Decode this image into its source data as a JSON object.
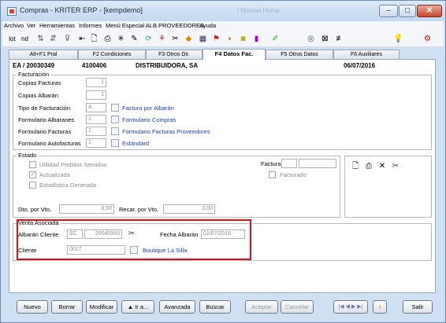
{
  "window": {
    "title": "Compras - KRITER ERP - [kempdemo]",
    "ghost_title": "! Normal   Home",
    "controls": {
      "minimize": "–",
      "maximize": "□",
      "close": "✕"
    }
  },
  "menu": [
    "Archivo",
    "Ver",
    "Herramientas",
    "Informes",
    "Menú Especial ALB.PROVEEDORES",
    "Ayuda"
  ],
  "toolbar": {
    "lot": "lot",
    "nd": "nd",
    "icons": [
      "sort-icon",
      "sort-desc-icon",
      "filter-icon",
      "back-icon",
      "preview-icon",
      "print-icon",
      "cross-icon",
      "edit-icon",
      "refresh-icon",
      "tree-icon",
      "tools-icon",
      "diamond-icon",
      "grid-icon",
      "flag-icon",
      "hide-icon",
      "camera-icon",
      "pencil-icon",
      "eye-icon",
      "image-icon",
      "tab-icon",
      "bulb-icon",
      "network-icon"
    ]
  },
  "tabs": [
    "Alt+F1 Pral",
    "F2 Condiciones",
    "F3 Otros Dir.",
    "F4 Datos Fac.",
    "F5 Otros Datos",
    "F6 Auxiliares"
  ],
  "header": {
    "doc": "EA / 20030349",
    "code": "4100406",
    "name": "DISTRIBUIDORA, SA",
    "date": "06/07/2016"
  },
  "facturacion": {
    "title": "Facturación",
    "copias_facturas": {
      "label": "Copias Facturas",
      "value": "1"
    },
    "copias_albaran": {
      "label": "Copias Albarán",
      "value": "1"
    },
    "tipo": {
      "label": "Tipo de Facturación",
      "value": "A",
      "desc": "Factura por Albarán"
    },
    "form_albaranes": {
      "label": "Formulario Albaranes",
      "value": "1",
      "desc": "Formulario Compras"
    },
    "form_facturas": {
      "label": "Formulario Facturas",
      "value": "1",
      "desc": "Formulario Facturas Proveedores"
    },
    "form_autofacturas": {
      "label": "Formulario Autofacturas",
      "value": "1",
      "desc": "Estándard"
    }
  },
  "estado": {
    "title": "Estado",
    "checks": [
      {
        "label": "Utilidad Pedidos Servidos",
        "checked": false
      },
      {
        "label": "Actualizada",
        "checked": true
      },
      {
        "label": "Estadística Generada",
        "checked": false
      }
    ],
    "factura_label": "Factura",
    "facturado_label": "Facturado",
    "dto_label": "Dto. por Vto.",
    "dto_value": "0,00",
    "recar_label": "Recar. por Vto.",
    "recar_value": "0,00"
  },
  "venta": {
    "title": "Venta Asociada",
    "albaran_label": "Albarán Cliente",
    "albaran_serie": "SC",
    "albaran_num": "20040993",
    "fecha_label": "Fecha Albarán",
    "fecha_value": "01/07/2016",
    "cliente_label": "Cliente",
    "cliente_value": "0017",
    "cliente_name": "Boutique La Silla"
  },
  "buttons": {
    "nuevo": "Nuevo",
    "borrar": "Borrar",
    "modificar": "Modificar",
    "ira": "▲ Ir a...",
    "avanzada": "Avanzada",
    "buscar": "Buscar",
    "aceptar": "Aceptar",
    "cancelar": "Cancelar",
    "salir": "Salir"
  }
}
